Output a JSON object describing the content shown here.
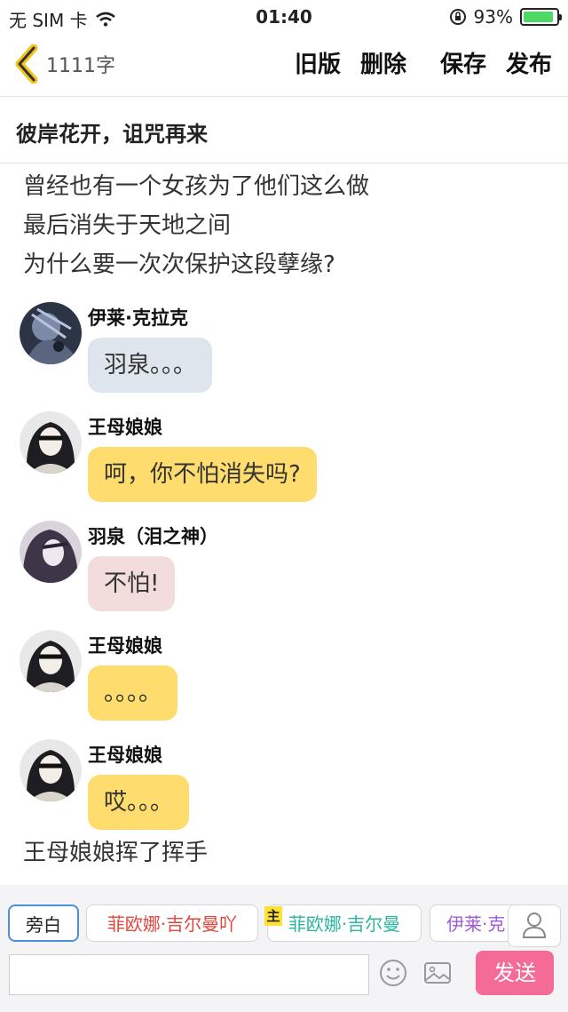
{
  "status_bar": {
    "carrier": "无 SIM 卡",
    "time": "01:40",
    "battery": "93%",
    "battery_level": 0.93
  },
  "nav": {
    "word_count": "1111字",
    "old_version": "旧版",
    "delete": "删除",
    "save": "保存",
    "publish": "发布"
  },
  "story_title": "彼岸花开，诅咒再来",
  "narration_top": [
    "曾经也有一个女孩为了他们这么做",
    "最后消失于天地之间",
    "为什么要一次次保护这段孽缘?"
  ],
  "messages": [
    {
      "name": "伊莱·克拉克",
      "text": "羽泉。。。",
      "bubble_color": "#dfe5ec"
    },
    {
      "name": "王母娘娘",
      "text": "呵，你不怕消失吗?",
      "bubble_color": "#ffdc6e"
    },
    {
      "name": "羽泉（泪之神）",
      "text": "不怕!",
      "bubble_color": "#f2dcdc"
    },
    {
      "name": "王母娘娘",
      "text": "。。。。",
      "bubble_color": "#ffdc6e"
    },
    {
      "name": "王母娘娘",
      "text": "哎。。。",
      "bubble_color": "#ffdc6e"
    }
  ],
  "narration_bottom": "王母娘娘挥了挥手",
  "characters": {
    "aside": "旁白",
    "list": [
      {
        "name": "菲欧娜·吉尔曼吖",
        "color": "#e0463c"
      },
      {
        "name": "菲欧娜·吉尔曼",
        "color": "#2bb5a0"
      },
      {
        "name": "伊莱·克",
        "color": "#a05ad6"
      }
    ],
    "main_badge": "主"
  },
  "composer": {
    "placeholder": "",
    "send": "发送"
  },
  "icons": [
    "chevron-left-icon",
    "wifi-icon",
    "orientation-lock-icon",
    "battery-icon",
    "user-icon",
    "emoji-icon",
    "image-icon"
  ]
}
